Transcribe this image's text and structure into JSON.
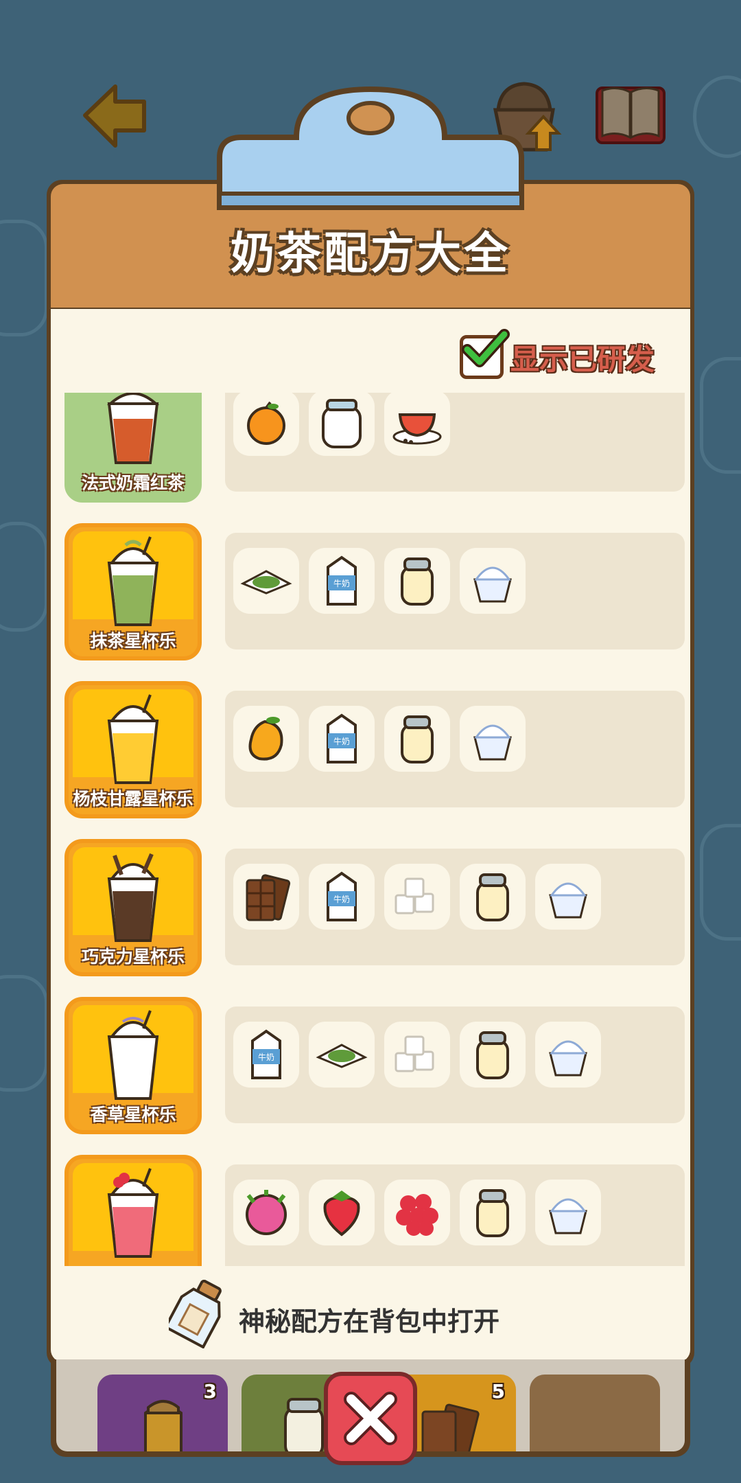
{
  "panel": {
    "title": "奶茶配方大全",
    "toggle_label": "显示已研发",
    "toggle_checked": true,
    "footer_note": "神秘配方在背包中打开"
  },
  "recipes": [
    {
      "name": "法式奶霜红茶",
      "state": "developed",
      "cup": "red-tea-cup",
      "ingredients": [
        "orange-icon",
        "jar-icon",
        "tea-cup-icon"
      ]
    },
    {
      "name": "抹茶星杯乐",
      "state": "locked",
      "cup": "matcha-cup",
      "ingredients": [
        "matcha-powder-icon",
        "milk-carton-icon",
        "condensed-milk-jar-icon",
        "ice-cream-icon"
      ]
    },
    {
      "name": "杨枝甘露星杯乐",
      "state": "locked",
      "cup": "mango-cup",
      "ingredients": [
        "mango-icon",
        "milk-carton-icon",
        "condensed-milk-jar-icon",
        "ice-cream-icon"
      ]
    },
    {
      "name": "巧克力星杯乐",
      "state": "locked",
      "cup": "chocolate-cup",
      "ingredients": [
        "chocolate-bar-icon",
        "milk-carton-icon",
        "sugar-cubes-icon",
        "condensed-milk-jar-icon",
        "ice-cream-icon"
      ]
    },
    {
      "name": "香草星杯乐",
      "state": "locked",
      "cup": "vanilla-cup",
      "ingredients": [
        "milk-carton-icon",
        "matcha-powder-icon",
        "sugar-cubes-icon",
        "condensed-milk-jar-icon",
        "ice-cream-icon"
      ]
    },
    {
      "name": "",
      "state": "locked",
      "cup": "strawberry-cup",
      "ingredients": [
        "dragon-fruit-icon",
        "strawberry-icon",
        "raspberry-icon",
        "condensed-milk-jar-icon",
        "ice-cream-icon"
      ]
    }
  ],
  "inventory_tray": [
    {
      "name": "honey-jar-slot",
      "count": "3",
      "color": "#6f3f84"
    },
    {
      "name": "jar-slot",
      "count": "",
      "color": "#6d7f3c"
    },
    {
      "name": "chocolate-slot",
      "count": "5",
      "color": "#d6951d"
    },
    {
      "name": "empty-slot",
      "count": "",
      "color": "#8b6a45"
    }
  ],
  "colors": {
    "background": "#3e6277",
    "panel_header": "#d19150",
    "panel_body": "#fbf6e7",
    "card_locked": "#ffc20e",
    "card_developed": "#a9cf86",
    "close_button": "#e64a55"
  }
}
